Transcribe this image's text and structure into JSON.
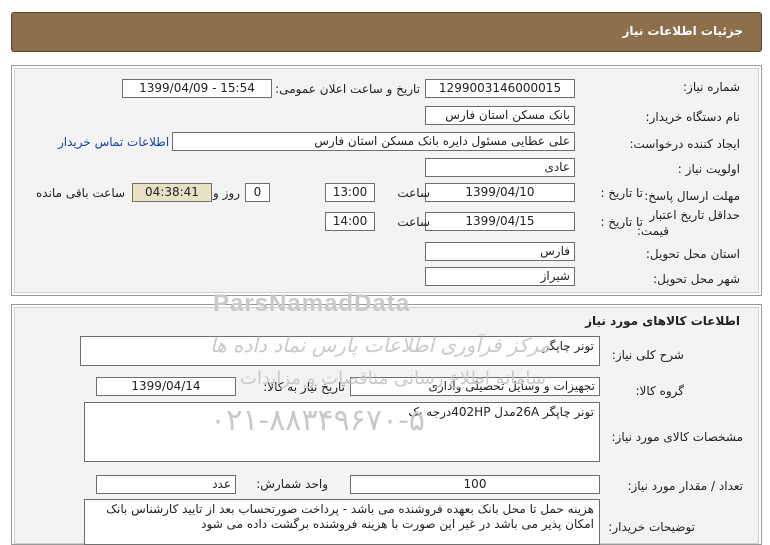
{
  "header": {
    "title": "جزئیات اطلاعات نیاز"
  },
  "need_info": {
    "need_number_label": "شماره نیاز:",
    "need_number": "1299003146000015",
    "announce_label": "تاریخ و ساعت اعلان عمومی:",
    "announce_value": "1399/04/09 - 15:54",
    "buyer_org_label": "نام دستگاه خریدار:",
    "buyer_org": "بانک مسکن استان فارس",
    "creator_label": "ایجاد کننده درخواست:",
    "creator": "علی عطایی مسئول دایره بانک مسکن استان فارس",
    "contact_link": "اطلاعات تماس خریدار",
    "priority_label": "اولویت نیاز :",
    "priority": "عادی",
    "reply_deadline_label": "مهلت ارسال پاسخ:",
    "to_date_label": "تا تاریخ :",
    "reply_date": "1399/04/10",
    "time_label": "ساعت",
    "reply_time": "13:00",
    "days_value": "0",
    "days_label": "روز و",
    "remaining_time": "04:38:41",
    "remaining_label": "ساعت باقی مانده",
    "price_validity_label_1": "حداقل تاریخ اعتبار",
    "price_validity_label_2": "قیمت:",
    "validity_to_date_label": "تا تاریخ :",
    "validity_date": "1399/04/15",
    "validity_time_label": "ساعت",
    "validity_time": "14:00",
    "province_label": "استان محل تحویل:",
    "province": "فارس",
    "city_label": "شهر محل تحویل:",
    "city": "شیراز"
  },
  "goods_info": {
    "section_title": "اطلاعات کالاهای مورد نیاز",
    "general_desc_label": "شرح کلی نیاز:",
    "general_desc": "تونر چاپگر",
    "group_label": "گروه کالا:",
    "group": "تجهیزات و وسایل تحصیلی واداری",
    "need_date_label": "تاریخ نیاز به کالا:",
    "need_date": "1399/04/14",
    "specs_label": "مشخصات کالای مورد نیاز:",
    "specs": "تونر چاپگر 26Aمدل 402HPدرجه یک",
    "quantity_label": "تعداد / مقدار مورد نیاز:",
    "quantity": "100",
    "unit_label": "واحد شمارش:",
    "unit": "عدد",
    "buyer_notes_label": "توضیحات خریدار:",
    "buyer_notes": "هزینه حمل تا محل بانک بعهده فروشنده می باشد - پرداخت صورتحساب بعد از تایید کارشناس بانک امکان پذیر می باشد در غیر این صورت با هزینه فروشنده برگشت داده می شود"
  },
  "watermark": {
    "brand": "ParsNamadData",
    "slogan": "مرکز فرآوری اطلاعات پارس نماد داده ها",
    "sub": "سامانه اطلاع رسانی مناقصات و مزایدات",
    "phone": "۰۲۱-۸۸۳۴۹۶۷۰-۵"
  }
}
